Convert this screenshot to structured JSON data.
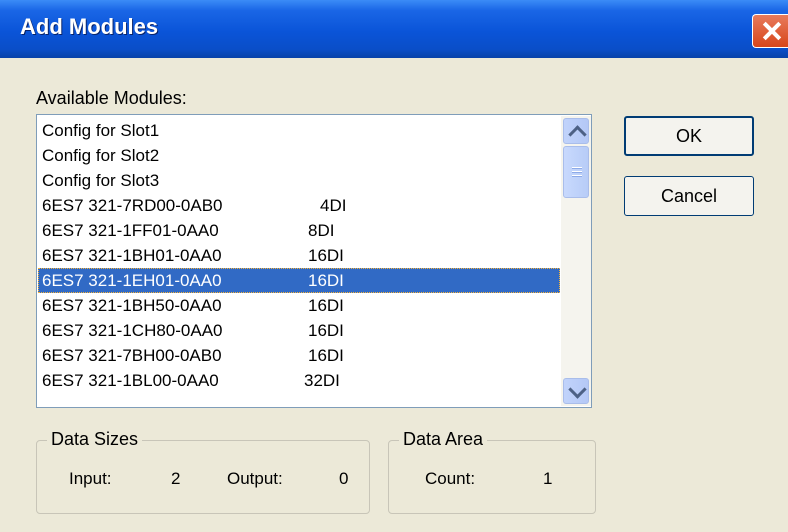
{
  "window": {
    "title": "Add Modules"
  },
  "available_label": "Available Modules:",
  "modules": [
    {
      "code": "Config for Slot1",
      "type": ""
    },
    {
      "code": "Config for Slot2",
      "type": ""
    },
    {
      "code": "Config for Slot3",
      "type": ""
    },
    {
      "code": "6ES7 321-7RD00-0AB0",
      "type": "4DI"
    },
    {
      "code": "6ES7 321-1FF01-0AA0",
      "type": "8DI"
    },
    {
      "code": "6ES7 321-1BH01-0AA0",
      "type": "16DI"
    },
    {
      "code": "6ES7 321-1EH01-0AA0",
      "type": "16DI"
    },
    {
      "code": "6ES7 321-1BH50-0AA0",
      "type": "16DI"
    },
    {
      "code": "6ES7 321-1CH80-0AA0",
      "type": "16DI"
    },
    {
      "code": "6ES7 321-7BH00-0AB0",
      "type": "16DI"
    },
    {
      "code": "6ES7 321-1BL00-0AA0",
      "type": "32DI"
    }
  ],
  "selected_index": 6,
  "buttons": {
    "ok": "OK",
    "cancel": "Cancel"
  },
  "data_sizes": {
    "label": "Data Sizes",
    "input_label": "Input:",
    "input_value": "2",
    "output_label": "Output:",
    "output_value": "0"
  },
  "data_area": {
    "label": "Data Area",
    "count_label": "Count:",
    "count_value": "1"
  },
  "icons": {
    "close": "close-icon",
    "scroll_up": "chevron-up-icon",
    "scroll_down": "chevron-down-icon"
  },
  "colors": {
    "title_bar": "#0a54d8",
    "selection": "#316ac5",
    "dialog_bg": "#ece9d8",
    "close_button": "#d8461b"
  }
}
